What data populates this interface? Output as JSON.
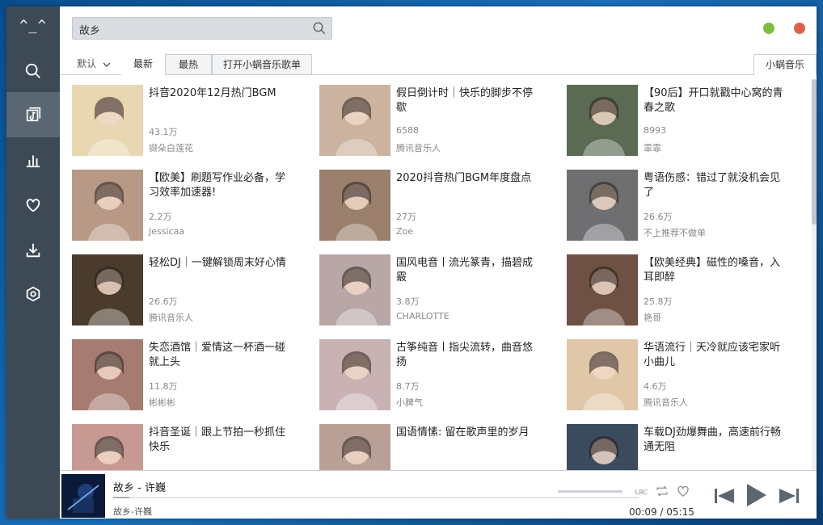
{
  "app": {
    "logo": "^_^",
    "search_value": "故乡",
    "accent_green": "#7cbd3c",
    "accent_red": "#e0614a"
  },
  "sidebar": {
    "items": [
      {
        "icon": "search-icon"
      },
      {
        "icon": "music-library-icon",
        "active": true
      },
      {
        "icon": "chart-icon"
      },
      {
        "icon": "heart-icon"
      },
      {
        "icon": "download-icon"
      },
      {
        "icon": "settings-icon"
      }
    ]
  },
  "tabs": {
    "sort_label": "默认",
    "items": [
      "最新",
      "最热",
      "打开小蜗音乐歌单"
    ],
    "right": "小蜗音乐"
  },
  "playlists": [
    {
      "title": "抖音2020年12月热门BGM",
      "count": "43.1万",
      "author": "撷朵白莲花",
      "color": "#e8d7b0"
    },
    {
      "title": "假日倒计时｜快乐的脚步不停歇",
      "count": "6588",
      "author": "腾讯音乐人",
      "color": "#cbb39f"
    },
    {
      "title": "【90后】开口就戳中心窝的青春之歌",
      "count": "8993",
      "author": "霏霏",
      "color": "#5b6b53"
    },
    {
      "title": "【欧美】刷题写作业必备，学习效率加速器!",
      "count": "2.2万",
      "author": "Jessicaa",
      "color": "#b89985"
    },
    {
      "title": "2020抖音热门BGM年度盘点",
      "count": "27万",
      "author": "Zoe",
      "color": "#9a7f6c"
    },
    {
      "title": "粤语伤感：错过了就没机会见了",
      "count": "26.6万",
      "author": "不上推荐不做单",
      "color": "#6f6f72"
    },
    {
      "title": "轻松DJ｜一键解锁周末好心情",
      "count": "26.6万",
      "author": "腾讯音乐人",
      "color": "#4a3b2c"
    },
    {
      "title": "国风电音丨流光篆青，描碧成霰",
      "count": "3.8万",
      "author": "CHARLOTTE",
      "color": "#b9a7a7"
    },
    {
      "title": "【欧美经典】磁性的嗓音，入耳即醉",
      "count": "25.8万",
      "author": "艳哥",
      "color": "#6e5142"
    },
    {
      "title": "失恋酒馆｜爱情这一杯酒一碰就上头",
      "count": "11.8万",
      "author": "彬彬彬",
      "color": "#a57b72"
    },
    {
      "title": "古筝纯音丨指尖流转，曲音悠扬",
      "count": "8.7万",
      "author": "小脾气",
      "color": "#c9b2b4"
    },
    {
      "title": "华语流行｜天冷就应该宅家听小曲儿",
      "count": "4.6万",
      "author": "腾讯音乐人",
      "color": "#e0c7a8"
    },
    {
      "title": "抖音圣诞｜跟上节拍一秒抓住快乐",
      "count": "",
      "author": "",
      "color": "#c79993"
    },
    {
      "title": "国语情愫: 留在歌声里的岁月",
      "count": "",
      "author": "",
      "color": "#b9a096"
    },
    {
      "title": "车载DJ劲爆舞曲，高速前行畅通无阻",
      "count": "",
      "author": "",
      "color": "#3a4b5e"
    }
  ],
  "player": {
    "title": "故乡 - 许巍",
    "subtitle": "故乡-许巍",
    "current_time": "00:09",
    "separator": "/",
    "total_time": "05:15",
    "progress_fraction": 0.03
  }
}
